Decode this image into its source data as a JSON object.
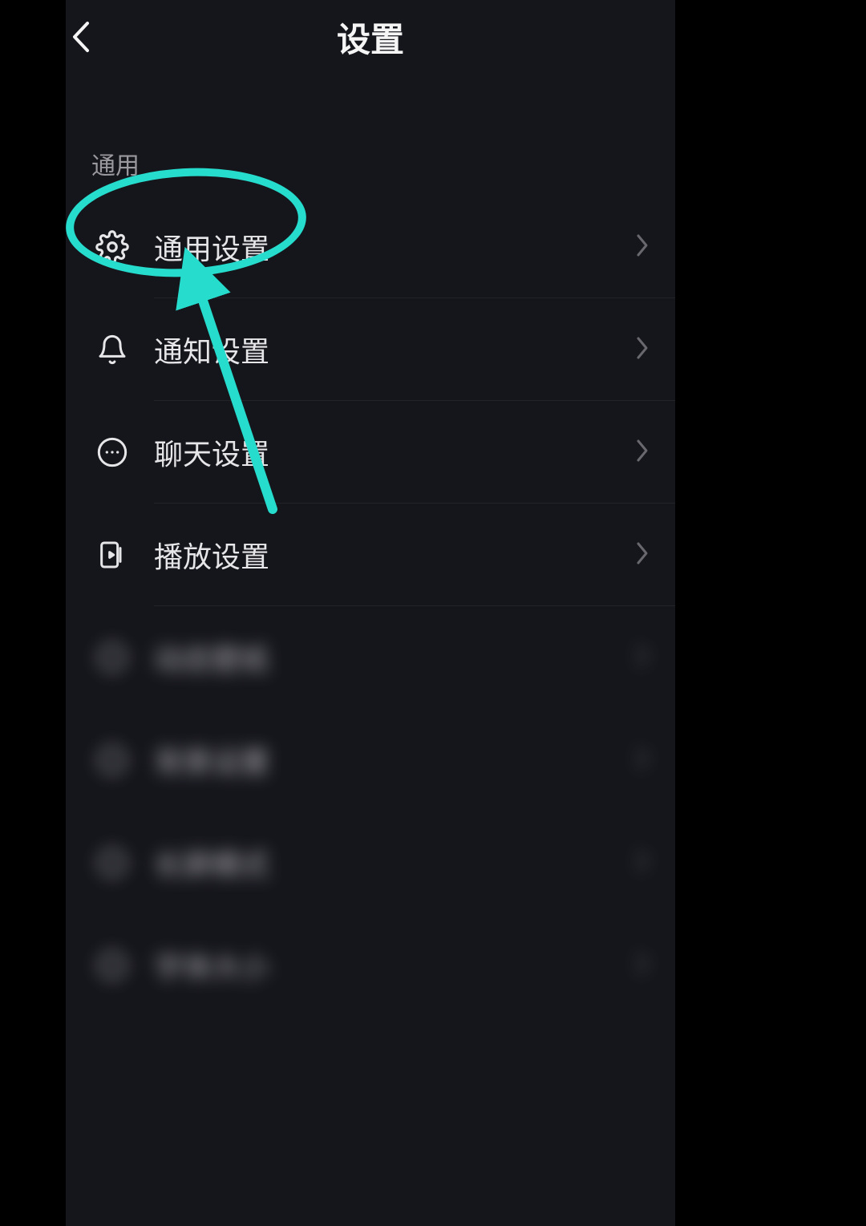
{
  "header": {
    "title": "设置"
  },
  "section": {
    "label": "通用"
  },
  "rows": [
    {
      "label": "通用设置"
    },
    {
      "label": "通知设置"
    },
    {
      "label": "聊天设置"
    },
    {
      "label": "播放设置"
    },
    {
      "label": "动态壁纸"
    },
    {
      "label": "背景设置"
    },
    {
      "label": "长屏模式"
    },
    {
      "label": "字体大小"
    }
  ],
  "annotation": {
    "color": "#26dccd"
  }
}
